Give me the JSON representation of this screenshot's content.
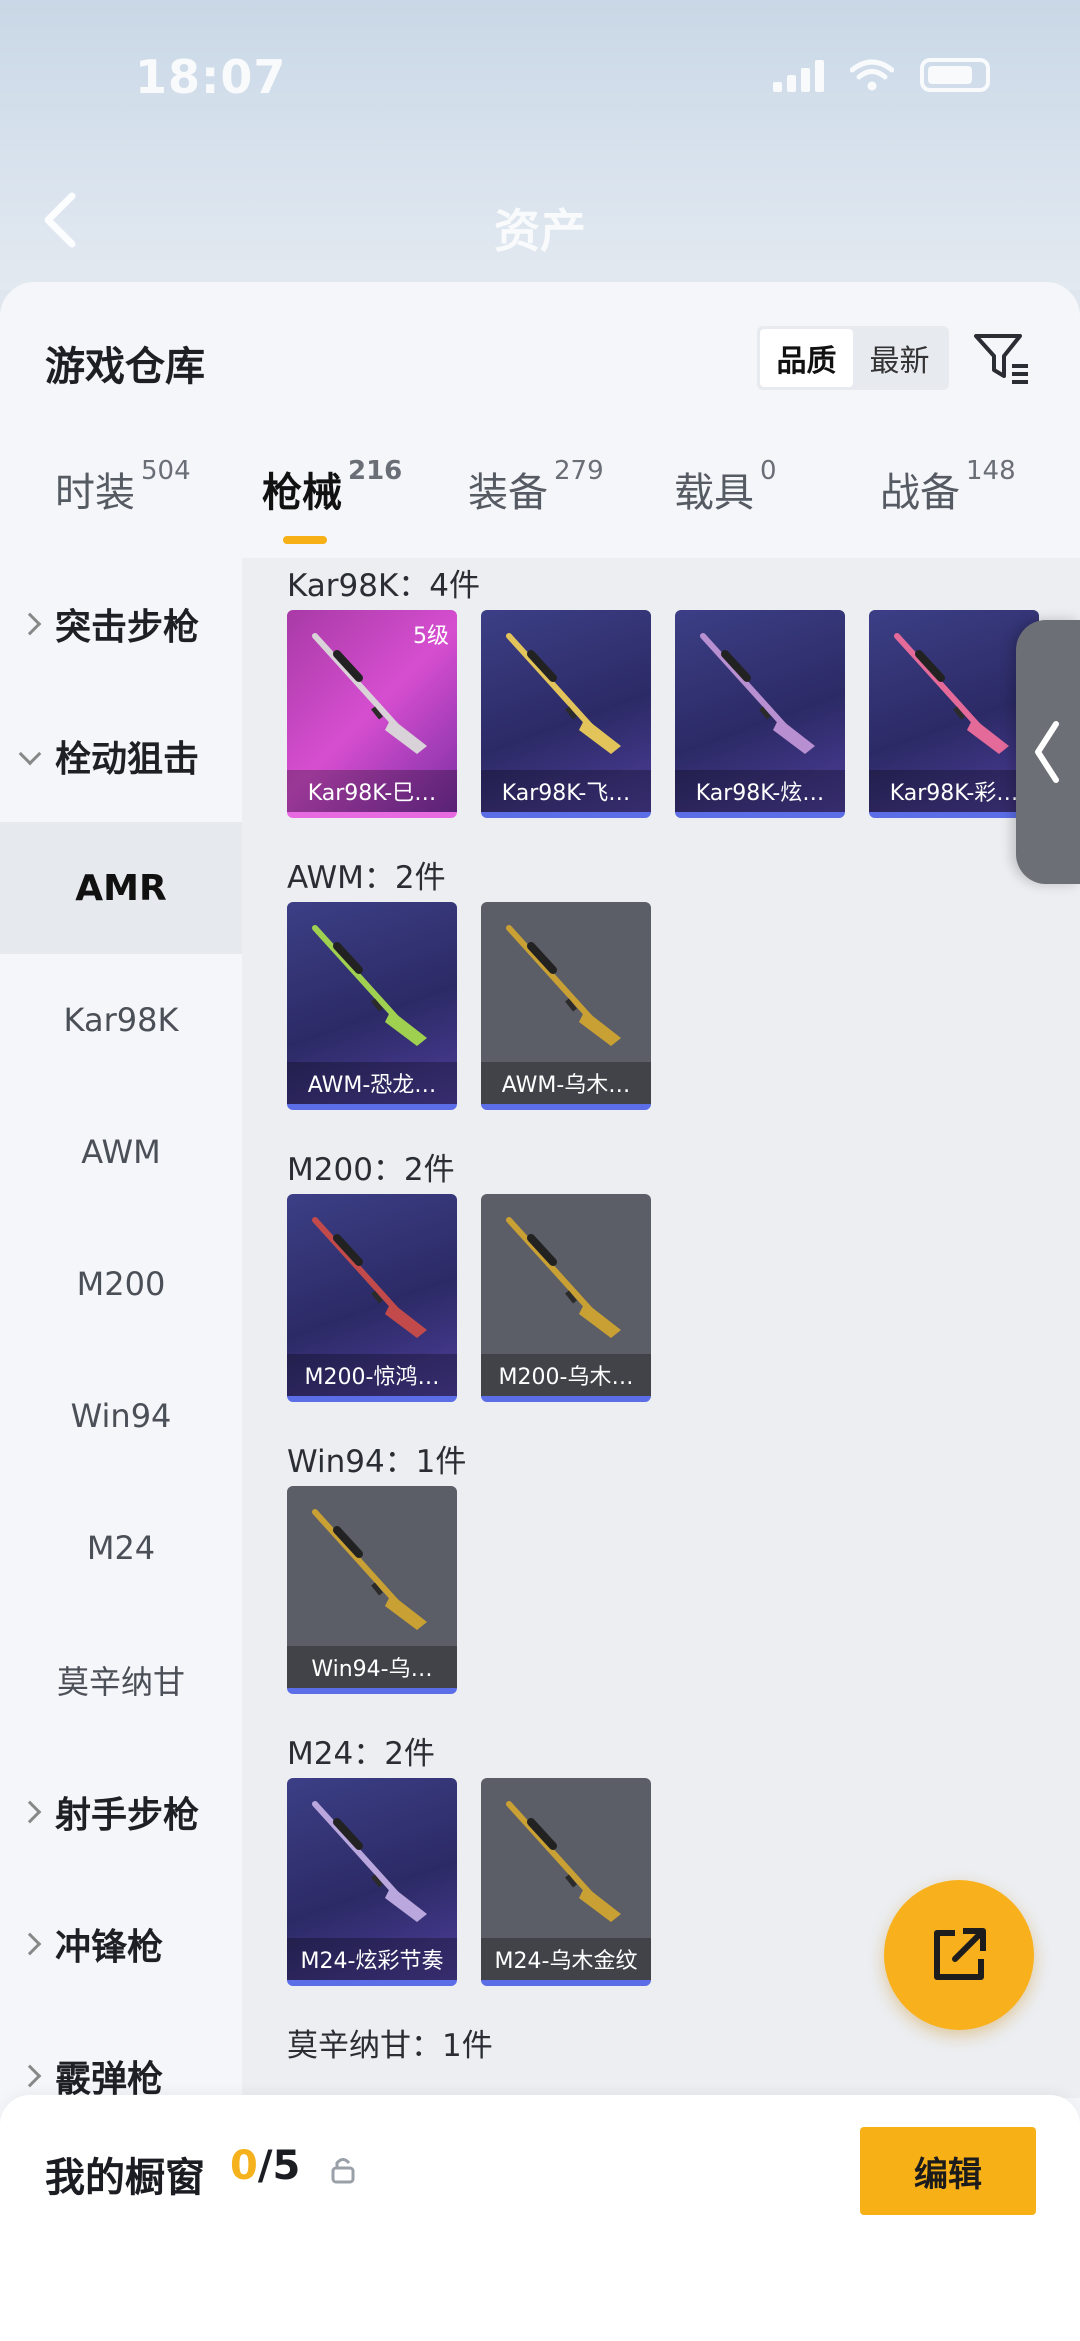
{
  "status_bar": {
    "time": "18:07"
  },
  "header": {
    "title": "资产"
  },
  "panel": {
    "title": "游戏仓库",
    "sort": {
      "options": [
        "品质",
        "最新"
      ],
      "selected": "品质"
    }
  },
  "tabs": [
    {
      "label": "时装",
      "count": "504"
    },
    {
      "label": "枪械",
      "count": "216",
      "active": true
    },
    {
      "label": "装备",
      "count": "279"
    },
    {
      "label": "载具",
      "count": "0"
    },
    {
      "label": "战备",
      "count": "148"
    }
  ],
  "sidebar": {
    "items": [
      {
        "label": "突击步枪",
        "type": "category"
      },
      {
        "label": "栓动狙击",
        "type": "category",
        "expanded": true
      },
      {
        "label": "AMR",
        "type": "sub",
        "selected": true
      },
      {
        "label": "Kar98K",
        "type": "sub"
      },
      {
        "label": "AWM",
        "type": "sub"
      },
      {
        "label": "M200",
        "type": "sub"
      },
      {
        "label": "Win94",
        "type": "sub"
      },
      {
        "label": "M24",
        "type": "sub"
      },
      {
        "label": "莫辛纳甘",
        "type": "sub"
      },
      {
        "label": "射手步枪",
        "type": "category"
      },
      {
        "label": "冲锋枪",
        "type": "category"
      },
      {
        "label": "霰弹枪",
        "type": "category"
      }
    ]
  },
  "groups": [
    {
      "title": "Kar98K：4件",
      "items": [
        {
          "name": "Kar98K-巳…",
          "style": "gold",
          "level": "5级",
          "gun": "#d9d2d8"
        },
        {
          "name": "Kar98K-飞…",
          "style": "purple",
          "gun": "#e2c45a"
        },
        {
          "name": "Kar98K-炫…",
          "style": "purple",
          "gun": "#b88fd0"
        },
        {
          "name": "Kar98K-彩…",
          "style": "purple",
          "gun": "#e46a9a"
        }
      ]
    },
    {
      "title": "AWM：2件",
      "items": [
        {
          "name": "AWM-恐龙…",
          "style": "purple",
          "gun": "#9fd04f"
        },
        {
          "name": "AWM-乌木…",
          "style": "gray",
          "gun": "#c9a033"
        }
      ]
    },
    {
      "title": "M200：2件",
      "items": [
        {
          "name": "M200-惊鸿…",
          "style": "purple",
          "gun": "#c24a4a"
        },
        {
          "name": "M200-乌木…",
          "style": "gray",
          "gun": "#c9a033"
        }
      ]
    },
    {
      "title": "Win94：1件",
      "items": [
        {
          "name": "Win94-乌…",
          "style": "gray",
          "gun": "#c9a033"
        }
      ]
    },
    {
      "title": "M24：2件",
      "items": [
        {
          "name": "M24-炫彩节奏",
          "style": "purple",
          "gun": "#b9a7dd"
        },
        {
          "name": "M24-乌木金纹",
          "style": "gray",
          "gun": "#c9a033"
        }
      ]
    },
    {
      "title": "莫辛纳甘：1件",
      "items": []
    }
  ],
  "showcase": {
    "label": "我的橱窗",
    "current": "0",
    "total": "/5",
    "edit_label": "编辑"
  },
  "colors": {
    "accent": "#f7b016",
    "panel_bg": "#f4f6f9",
    "content_bg": "#eceef1"
  }
}
